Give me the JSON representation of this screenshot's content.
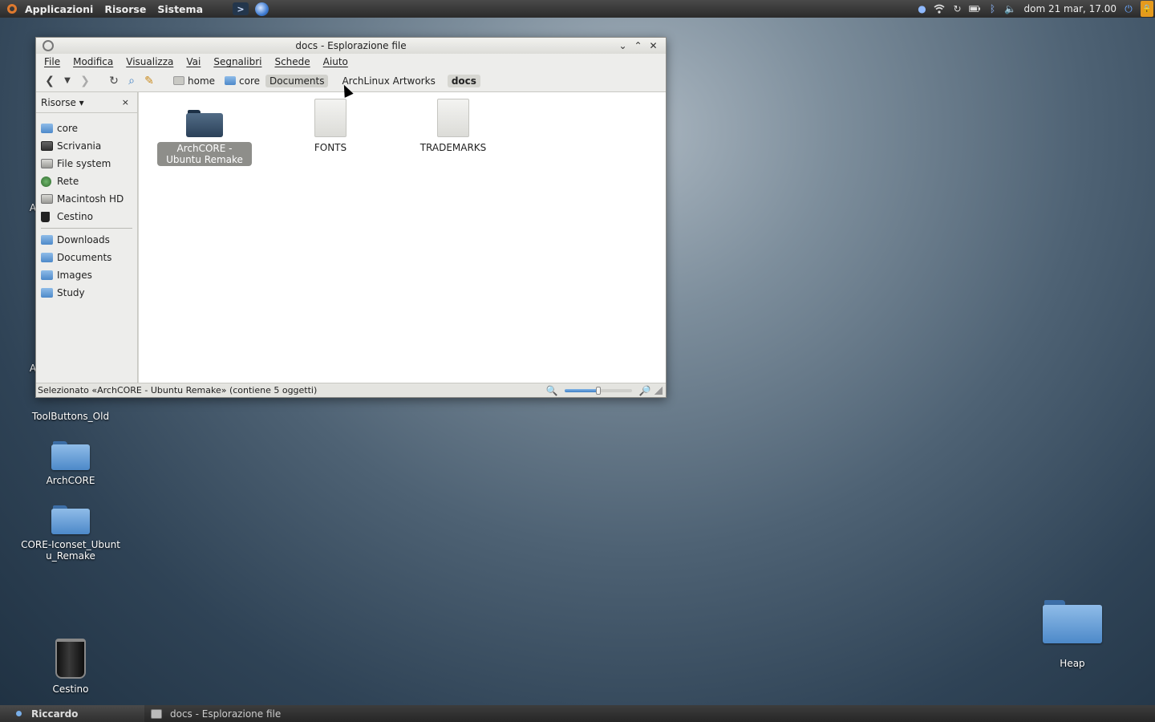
{
  "top_panel": {
    "menus": [
      "Applicazioni",
      "Risorse",
      "Sistema"
    ],
    "launchers": [
      ">"
    ],
    "tray_icons": [
      "status-dot-icon",
      "wifi-icon",
      "update-icon",
      "battery-icon",
      "bluetooth-icon",
      "volume-icon"
    ],
    "clock": "dom 21 mar, 17.00"
  },
  "desktop": {
    "icons": [
      {
        "label": "ToolButtons_Old"
      },
      {
        "label": "ArchCORE"
      },
      {
        "label": "CORE-Iconset_Ubuntu_Remake"
      },
      {
        "label": "Cestino"
      },
      {
        "label": "Heap"
      }
    ],
    "partial_label": "A"
  },
  "window": {
    "title": "docs - Esplorazione file",
    "menubar": [
      "File",
      "Modifica",
      "Visualizza",
      "Vai",
      "Segnalibri",
      "Schede",
      "Aiuto"
    ],
    "breadcrumb": [
      "home",
      "core",
      "Documents",
      "ArchLinux Artworks",
      "docs"
    ],
    "sidebar": {
      "header": "Risorse ▾",
      "close": "×",
      "places": [
        "core",
        "Scrivania",
        "File system",
        "Rete",
        "Macintosh HD",
        "Cestino"
      ],
      "bookmarks": [
        "Downloads",
        "Documents",
        "Images",
        "Study"
      ]
    },
    "files": [
      {
        "name": "ArchCORE - Ubuntu Remake",
        "type": "folder",
        "selected": true
      },
      {
        "name": "FONTS",
        "type": "document"
      },
      {
        "name": "TRADEMARKS",
        "type": "document"
      }
    ],
    "status": "Selezionato «ArchCORE - Ubuntu Remake» (contiene 5 oggetti)",
    "zoom_level": 0.5
  },
  "bottom_panel": {
    "user": "Riccardo",
    "task": "docs - Esplorazione file"
  }
}
